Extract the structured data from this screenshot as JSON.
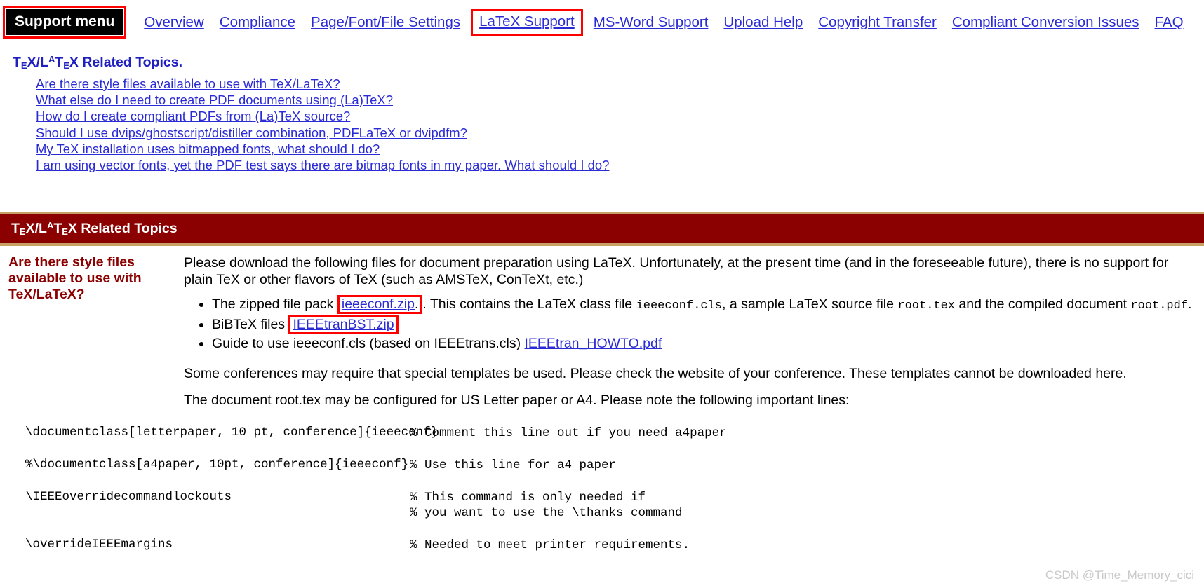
{
  "nav": {
    "menu_label": "Support menu",
    "items": [
      {
        "label": "Overview",
        "highlighted": false
      },
      {
        "label": "Compliance",
        "highlighted": false
      },
      {
        "label": "Page/Font/File Settings",
        "highlighted": false
      },
      {
        "label": "LaTeX Support",
        "highlighted": true
      },
      {
        "label": "MS-Word Support",
        "highlighted": false
      },
      {
        "label": "Upload Help",
        "highlighted": false
      },
      {
        "label": "Copyright Transfer",
        "highlighted": false
      },
      {
        "label": "Compliant Conversion Issues",
        "highlighted": false
      },
      {
        "label": "FAQ",
        "highlighted": false
      }
    ]
  },
  "topics": {
    "heading_prefix": "T",
    "heading_text": "X/L",
    "heading_full": "TEX/LATEX Related Topics.",
    "links": [
      "Are there style files available to use with TeX/LaTeX?",
      "What else do I need to create PDF documents using (La)TeX?",
      "How do I create compliant PDFs from (La)TeX source?",
      "Should I use dvips/ghostscript/distiller combination, PDFLaTeX or dvipdfm?",
      "My TeX installation uses bitmapped fonts, what should I do?",
      "I am using vector fonts, yet the PDF test says there are bitmap fonts in my paper. What should I do?"
    ]
  },
  "banner": {
    "title_full": "TEX/LATEX Related Topics"
  },
  "qa": {
    "question": "Are there style files available to use with TeX/LaTeX?",
    "intro_paragraph": "Please download the following files for document preparation using LaTeX. Unfortunately, at the present time (and in the foreseeable future), there is no support for plain TeX or other flavors of TeX (such as AMSTeX, ConTeXt, etc.)",
    "files": [
      {
        "pre": "The zipped file pack ",
        "link": "ieeeconf.zip",
        "link_boxed": true,
        "mid1": ". This contains the LaTeX class file ",
        "mono1": "ieeeconf.cls",
        "mid2": ", a sample LaTeX source file ",
        "mono2": "root.tex",
        "mid3": " and the compiled document ",
        "mono3": "root.pdf",
        "post": "."
      },
      {
        "pre": "BiBTeX files ",
        "link": "IEEEtranBST.zip",
        "link_boxed": true,
        "post": ""
      },
      {
        "pre": "Guide to use ieeeconf.cls (based on IEEEtrans.cls) ",
        "link": "IEEEtran_HOWTO.pdf",
        "link_boxed": false,
        "post": ""
      }
    ],
    "templates_paragraph": "Some conferences may require that special templates be used. Please check the website of your conference. These templates cannot be downloaded here.",
    "config_paragraph": "The document root.tex may be configured for US Letter paper or A4. Please note the following important lines:"
  },
  "code_lines": [
    {
      "command": "\\documentclass[letterpaper, 10 pt, conference]{ieeeconf}",
      "comment": "% Comment this line out if you need a4paper"
    },
    {
      "command": "%\\documentclass[a4paper, 10pt, conference]{ieeeconf}",
      "comment": "% Use this line for a4 paper"
    },
    {
      "command": "\\IEEEoverridecommandlockouts",
      "comment": "% This command is only needed if\n% you want to use the \\thanks command"
    },
    {
      "command": "\\overrideIEEEmargins",
      "comment": "% Needed to meet printer requirements."
    }
  ],
  "watermark": "CSDN @Time_Memory_cici",
  "colors": {
    "link": "#2b2bd6",
    "banner_bg": "#8b0000",
    "banner_border": "#c8a063",
    "highlight_box": "#ff0000",
    "question": "#8b0000",
    "heading": "#2020c0"
  }
}
